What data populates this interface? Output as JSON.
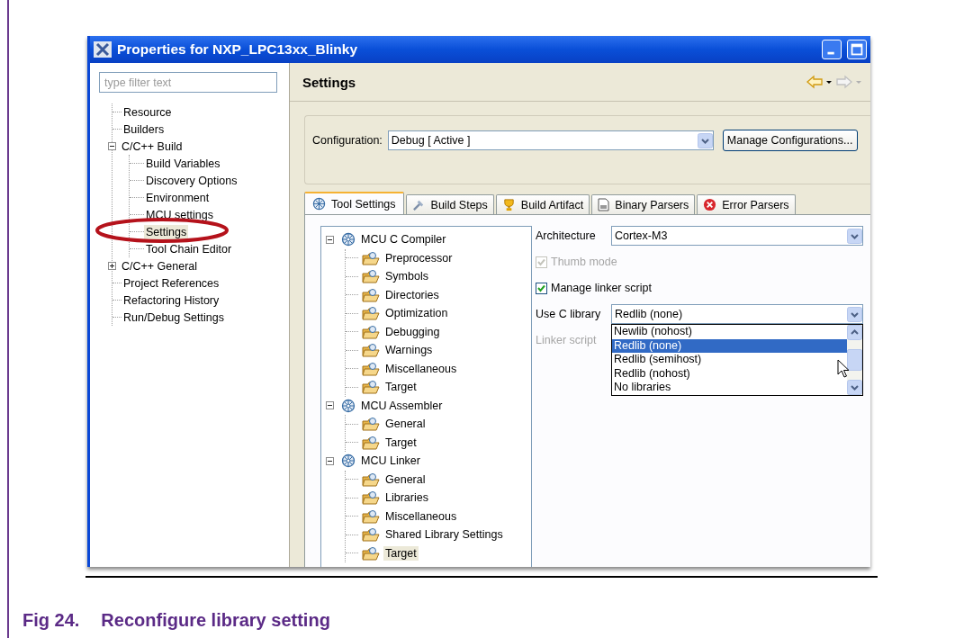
{
  "window": {
    "title": "Properties for NXP_LPC13xx_Blinky"
  },
  "sidebar": {
    "filter": {
      "placeholder": "type filter text"
    },
    "tree": [
      {
        "label": "Resource",
        "selected": false
      },
      {
        "label": "Builders",
        "selected": false
      },
      {
        "label": "C/C++ Build",
        "selected": false,
        "expanded": true,
        "children": [
          {
            "label": "Build Variables",
            "selected": false
          },
          {
            "label": "Discovery Options",
            "selected": false
          },
          {
            "label": "Environment",
            "selected": false
          },
          {
            "label": "MCU settings",
            "selected": false
          },
          {
            "label": "Settings",
            "selected": true
          },
          {
            "label": "Tool Chain Editor",
            "selected": false
          }
        ]
      },
      {
        "label": "C/C++ General",
        "selected": false,
        "expanded": false
      },
      {
        "label": "Project References",
        "selected": false
      },
      {
        "label": "Refactoring History",
        "selected": false
      },
      {
        "label": "Run/Debug Settings",
        "selected": false
      }
    ]
  },
  "page": {
    "title": "Settings"
  },
  "configuration": {
    "label": "Configuration:",
    "value": "Debug  [ Active ]",
    "button": "Manage Configurations..."
  },
  "tabs": [
    {
      "label": "Tool Settings",
      "selected": true
    },
    {
      "label": "Build Steps",
      "selected": false
    },
    {
      "label": "Build Artifact",
      "selected": false
    },
    {
      "label": "Binary Parsers",
      "selected": false
    },
    {
      "label": "Error Parsers",
      "selected": false
    }
  ],
  "tool_tree": [
    {
      "label": "MCU C Compiler",
      "expanded": true,
      "children": [
        {
          "label": "Preprocessor",
          "selected": false
        },
        {
          "label": "Symbols",
          "selected": false
        },
        {
          "label": "Directories",
          "selected": false
        },
        {
          "label": "Optimization",
          "selected": false
        },
        {
          "label": "Debugging",
          "selected": false
        },
        {
          "label": "Warnings",
          "selected": false
        },
        {
          "label": "Miscellaneous",
          "selected": false
        },
        {
          "label": "Target",
          "selected": false
        }
      ]
    },
    {
      "label": "MCU Assembler",
      "expanded": true,
      "children": [
        {
          "label": "General",
          "selected": false
        },
        {
          "label": "Target",
          "selected": false
        }
      ]
    },
    {
      "label": "MCU Linker",
      "expanded": true,
      "children": [
        {
          "label": "General",
          "selected": false
        },
        {
          "label": "Libraries",
          "selected": false
        },
        {
          "label": "Miscellaneous",
          "selected": false
        },
        {
          "label": "Shared Library Settings",
          "selected": false
        },
        {
          "label": "Target",
          "selected": true
        }
      ]
    }
  ],
  "options": [
    {
      "kind": "select",
      "label": "Architecture",
      "value": "Cortex-M3"
    },
    {
      "kind": "checkbox",
      "label": "Thumb mode",
      "checked": true,
      "disabled": true
    },
    {
      "kind": "checkbox",
      "label": "Manage linker script",
      "checked": true,
      "disabled": false
    },
    {
      "kind": "dropdown",
      "label": "Use C library",
      "value": "Redlib (none)",
      "expanded": true,
      "choices": [
        {
          "label": "Newlib (nohost)",
          "selected": false
        },
        {
          "label": "Redlib (none)",
          "selected": true
        },
        {
          "label": "Redlib (semihost)",
          "selected": false
        },
        {
          "label": "Redlib (nohost)",
          "selected": false
        },
        {
          "label": "No libraries",
          "selected": false
        }
      ]
    },
    {
      "kind": "label",
      "label": "Linker script",
      "disabled": true
    }
  ],
  "caption": {
    "number": "Fig 24.",
    "text": "Reconfigure library setting"
  }
}
